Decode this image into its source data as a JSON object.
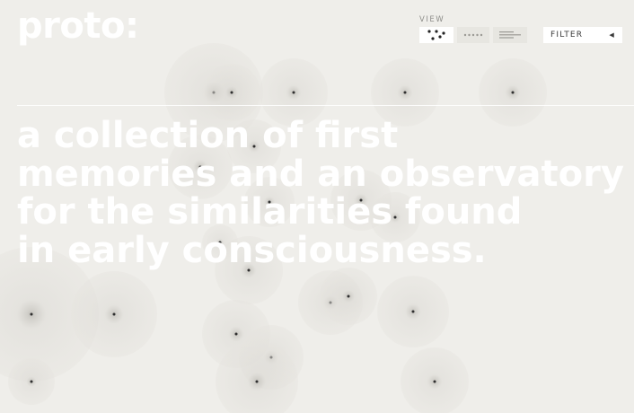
{
  "header": {
    "logo": "proto:",
    "view_label": "VIEW",
    "view_options": [
      {
        "name": "map",
        "icon": "scatter-dots-icon",
        "active": true
      },
      {
        "name": "grid",
        "icon": "dot-row-icon",
        "active": false
      },
      {
        "name": "list",
        "icon": "lines-icon",
        "active": false
      }
    ],
    "filter": {
      "label": "FILTER",
      "icon": "caret-left-icon"
    }
  },
  "tagline": [
    "a collection of first",
    "memories and an observatory",
    "for the similarities found",
    "in early consciousness."
  ],
  "colors": {
    "background": "#efeeea",
    "text": "#ffffff",
    "dot": "#2f2f2f",
    "halo": "#c8c6c0"
  },
  "memory_count": 22
}
